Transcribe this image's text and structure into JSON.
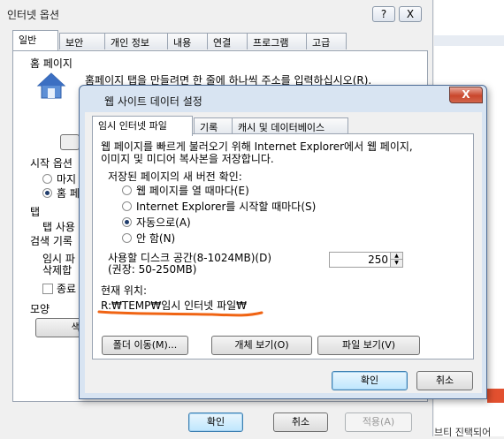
{
  "internet_options": {
    "title": "인터넷 옵션",
    "help_btn": "?",
    "close_btn": "X",
    "tabs": [
      "일반",
      "보안",
      "개인 정보",
      "내용",
      "연결",
      "프로그램",
      "고급"
    ],
    "homepage_group": "홈 페이지",
    "homepage_text": "홈페이지 탭을 만들려면 한 줄에 하나씩 주소를 입력하십시오(R).",
    "startup_group": "시작 옵션",
    "startup_opt1": "마지",
    "startup_opt2": "홈 페",
    "tabs_group": "탭",
    "tabs_text": "탭 사용",
    "history_group": "검색 기록",
    "history_line1": "임시 파",
    "history_line2": "삭제합",
    "history_check": "종료",
    "appearance_group": "모양",
    "colors_btn": "색(",
    "ok_btn": "확인",
    "cancel_btn": "취소",
    "apply_btn": "적용(A)",
    "truncated_right": "브티 진택되어"
  },
  "dialog": {
    "title": "웹 사이트 데이터 설정",
    "close": "X",
    "tabs": [
      "임시 인터넷 파일",
      "기록",
      "캐시 및 데이터베이스"
    ],
    "desc_line1": "웹 페이지를 빠르게 불러오기 위해 Internet Explorer에서 웹 페이지,",
    "desc_line2": "이미지 및 미디어 복사본을 저장합니다.",
    "check_label": "저장된 페이지의 새 버전 확인:",
    "options": [
      {
        "label": "웹 페이지를 열 때마다(E)",
        "selected": false
      },
      {
        "label": "Internet Explorer를 시작할 때마다(S)",
        "selected": false
      },
      {
        "label": "자동으로(A)",
        "selected": true
      },
      {
        "label": "안 함(N)",
        "selected": false
      }
    ],
    "disk_label1": "사용할 디스크 공간(8-1024MB)(D)",
    "disk_label2": "(권장: 50-250MB)",
    "disk_value": "250",
    "location_label": "현재 위치:",
    "location_value": "R:₩TEMP₩임시 인터넷 파일₩",
    "move_btn": "폴더 이동(M)...",
    "objects_btn": "개체 보기(O)",
    "files_btn": "파일 보기(V)",
    "ok_btn": "확인",
    "cancel_btn": "취소"
  }
}
